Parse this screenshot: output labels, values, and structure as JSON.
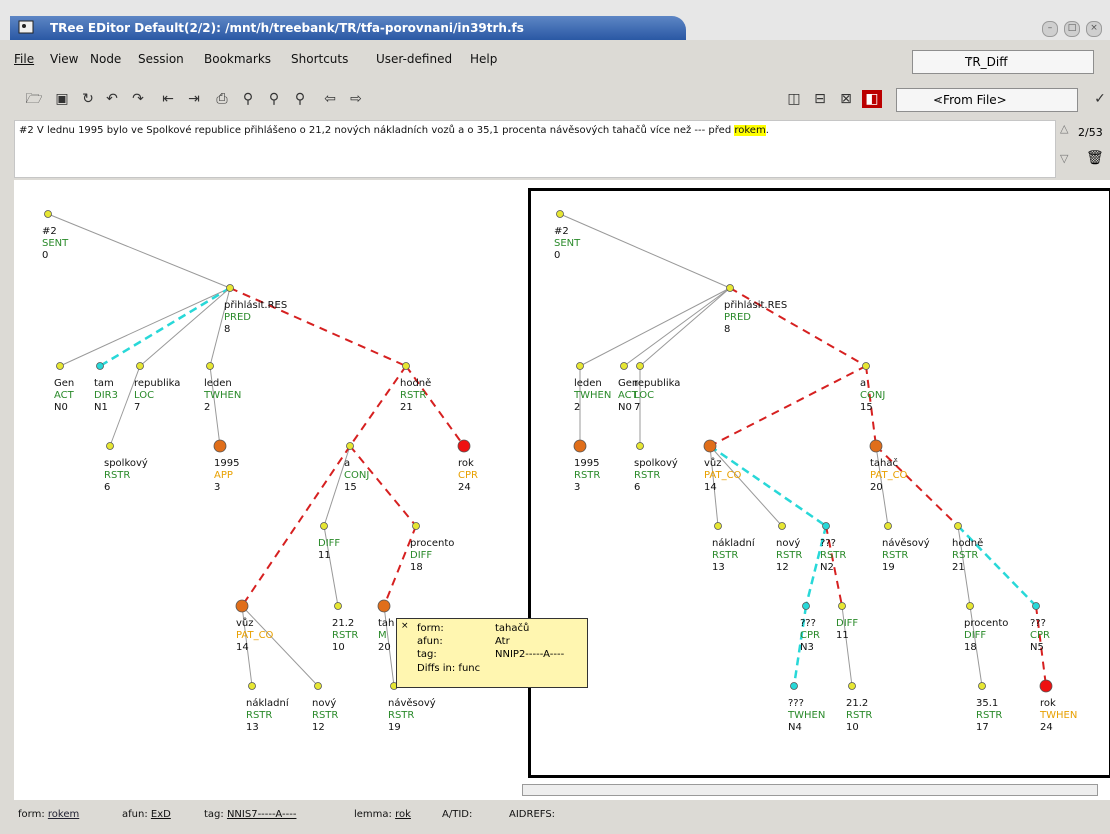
{
  "window": {
    "title": "TRee EDitor    Default(2/2): /mnt/h/treebank/TR/tfa-porovnani/in39trh.fs",
    "buttons": [
      "minimize-icon",
      "maximize-icon",
      "close-icon"
    ]
  },
  "menu": {
    "items": [
      {
        "label": "File"
      },
      {
        "label": "View"
      },
      {
        "label": "Node"
      },
      {
        "label": "Session"
      },
      {
        "label": "Bookmarks"
      },
      {
        "label": "Shortcuts"
      },
      {
        "label": "User-defined"
      },
      {
        "label": "Help"
      }
    ],
    "profile": "TR_Diff"
  },
  "toolbar": {
    "style_select": "<From File>"
  },
  "sentence": {
    "text": "#2 V lednu 1995 bylo ve Spolkové republice přihlášeno o 21,2  nových nákladních vozů a o 35,1 procenta návěsových tahačů více než --- před ",
    "highlight": "rokem",
    "tail": "."
  },
  "nav": {
    "count": "2/53"
  },
  "tooltip": {
    "form": "tahačů",
    "afun": "Atr",
    "tag": "NNIP2-----A----",
    "diffs": "Diffs in: func"
  },
  "status": {
    "form_label": "form:",
    "form_value": "rokem",
    "afun_label": "afun:",
    "afun_value": "ExD",
    "tag_label": "tag:",
    "tag_value": "NNIS7-----A----",
    "lemma_label": "lemma:",
    "lemma_value": "rok",
    "atid": "A/TID:",
    "aidrefs": "AIDREFS:"
  },
  "left_tree": {
    "nodes": [
      {
        "id": "root",
        "t1": "#2",
        "t2": "SENT",
        "t3": "0"
      },
      {
        "id": "prihlasit",
        "t1": "přihlásit.RES",
        "t2": "PRED",
        "t3": "8"
      },
      {
        "id": "gen",
        "t1": "Gen",
        "t2": "ACT",
        "t3": "N0"
      },
      {
        "id": "tam",
        "t1": "tam",
        "t2": "DIR3",
        "t3": "N1"
      },
      {
        "id": "republika",
        "t1": "republika",
        "t2": "LOC",
        "t3": "7"
      },
      {
        "id": "leden",
        "t1": "leden",
        "t2": "TWHEN",
        "t3": "2"
      },
      {
        "id": "hodne",
        "t1": "hodně",
        "t2": "RSTR",
        "t3": "21"
      },
      {
        "id": "spolkovy",
        "t1": "spolkový",
        "t2": "RSTR",
        "t3": "6"
      },
      {
        "id": "n1995",
        "t1": "1995",
        "t2": "APP",
        "t3": "3"
      },
      {
        "id": "a",
        "t1": "a",
        "t2": "CONJ",
        "t3": "15"
      },
      {
        "id": "rok",
        "t1": "rok",
        "t2": "CPR",
        "t3": "24"
      },
      {
        "id": "diff",
        "t1": "DIFF",
        "t2": "11",
        "t3": ""
      },
      {
        "id": "procento",
        "t1": "procento",
        "t2": "DIFF",
        "t3": "18"
      },
      {
        "id": "vuz",
        "t1": "vůz",
        "t2": "PAT_CO",
        "t3": "14"
      },
      {
        "id": "n212",
        "t1": "21.2",
        "t2": "RSTR",
        "t3": "10"
      },
      {
        "id": "tahac",
        "t1": "tah",
        "t2": "M",
        "t3": "20"
      },
      {
        "id": "nakladni",
        "t1": "nákladní",
        "t2": "RSTR",
        "t3": "13"
      },
      {
        "id": "novy",
        "t1": "nový",
        "t2": "RSTR",
        "t3": "12"
      },
      {
        "id": "navesovy",
        "t1": "návěsový",
        "t2": "RSTR",
        "t3": "19"
      }
    ]
  },
  "right_tree": {
    "nodes": [
      {
        "id": "root",
        "t1": "#2",
        "t2": "SENT",
        "t3": "0"
      },
      {
        "id": "prihlasit",
        "t1": "přihlásit.RES",
        "t2": "PRED",
        "t3": "8"
      },
      {
        "id": "leden",
        "t1": "leden",
        "t2": "TWHEN",
        "t3": "2"
      },
      {
        "id": "gen",
        "t1": "Gen",
        "t2": "ACT",
        "t3": "N0"
      },
      {
        "id": "republika",
        "t1": "republika",
        "t2": "LOC",
        "t3": "7"
      },
      {
        "id": "a",
        "t1": "a",
        "t2": "CONJ",
        "t3": "15"
      },
      {
        "id": "n1995",
        "t1": "1995",
        "t2": "RSTR",
        "t3": "3"
      },
      {
        "id": "spolkovy",
        "t1": "spolkový",
        "t2": "RSTR",
        "t3": "6"
      },
      {
        "id": "vuz",
        "t1": "vůz",
        "t2": "PAT_CO",
        "t3": "14"
      },
      {
        "id": "tahac",
        "t1": "tahač",
        "t2": "PAT_CO",
        "t3": "20"
      },
      {
        "id": "nakladni",
        "t1": "nákladní",
        "t2": "RSTR",
        "t3": "13"
      },
      {
        "id": "novy",
        "t1": "nový",
        "t2": "RSTR",
        "t3": "12"
      },
      {
        "id": "q1",
        "t1": "???",
        "t2": "RSTR",
        "t3": "N2"
      },
      {
        "id": "navesovy",
        "t1": "návěsový",
        "t2": "RSTR",
        "t3": "19"
      },
      {
        "id": "hodne",
        "t1": "hodně",
        "t2": "RSTR",
        "t3": "21"
      },
      {
        "id": "q2",
        "t1": "???",
        "t2": "CPR",
        "t3": "N3"
      },
      {
        "id": "diff",
        "t1": "DIFF",
        "t2": "11",
        "t3": ""
      },
      {
        "id": "procento",
        "t1": "procento",
        "t2": "DIFF",
        "t3": "18"
      },
      {
        "id": "q3",
        "t1": "???",
        "t2": "CPR",
        "t3": "N5"
      },
      {
        "id": "q4",
        "t1": "???",
        "t2": "TWHEN",
        "t3": "N4"
      },
      {
        "id": "n212",
        "t1": "21.2",
        "t2": "RSTR",
        "t3": "10"
      },
      {
        "id": "n351",
        "t1": "35.1",
        "t2": "RSTR",
        "t3": "17"
      },
      {
        "id": "rok",
        "t1": "rok",
        "t2": "TWHEN",
        "t3": "24"
      }
    ]
  },
  "colors": {
    "green": "#2a8a2a",
    "orange": "#e8a000",
    "diff_red": "#d62020",
    "diff_cyan": "#28d8d8",
    "node_yellow": "#e6e633",
    "node_orange": "#e06e1a",
    "node_red": "#ee1111"
  }
}
